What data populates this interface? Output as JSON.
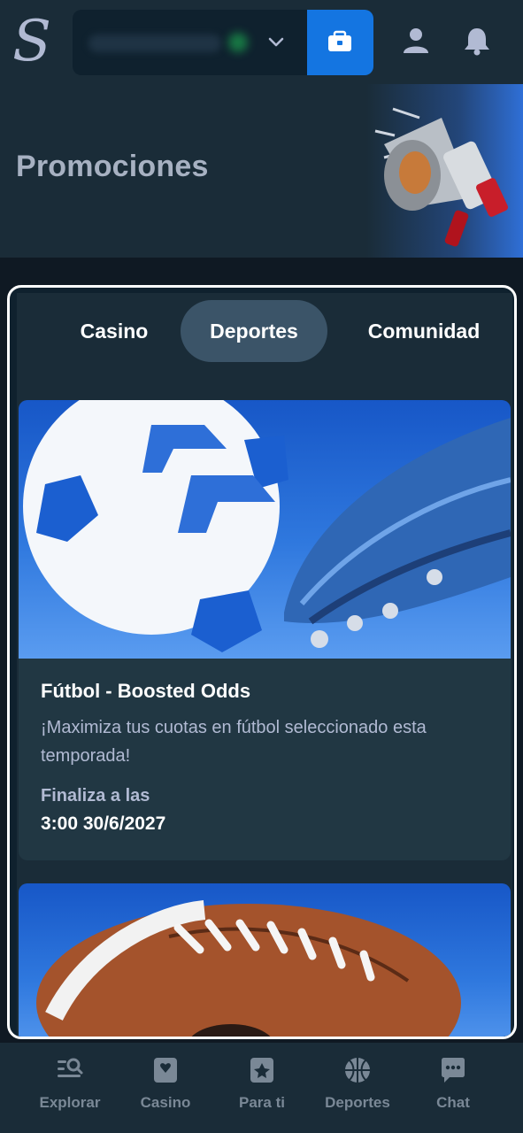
{
  "header": {
    "logo_text": "S",
    "icons": [
      "logo",
      "chevron-down-icon",
      "wallet-icon",
      "user-icon",
      "bell-icon"
    ]
  },
  "hero": {
    "title": "Promociones"
  },
  "tabs": [
    {
      "label": "Casino",
      "active": false
    },
    {
      "label": "Deportes",
      "active": true
    },
    {
      "label": "Comunidad",
      "active": false
    }
  ],
  "promotions": [
    {
      "title": "Fútbol - Boosted Odds",
      "description": "¡Maximiza tus cuotas en fútbol seleccionado esta temporada!",
      "ends_label": "Finaliza a las",
      "ends_date": "3:00 30/6/2027"
    }
  ],
  "bottom_nav": [
    {
      "label": "Explorar",
      "icon": "search-list-icon"
    },
    {
      "label": "Casino",
      "icon": "casino-card-icon"
    },
    {
      "label": "Para ti",
      "icon": "for-you-icon"
    },
    {
      "label": "Deportes",
      "icon": "basketball-icon"
    },
    {
      "label": "Chat",
      "icon": "chat-icon"
    }
  ],
  "colors": {
    "background": "#0f1923",
    "surface": "#1a2c38",
    "card": "#213743",
    "accent_blue": "#1475e1",
    "muted_text": "#b1bad3"
  }
}
